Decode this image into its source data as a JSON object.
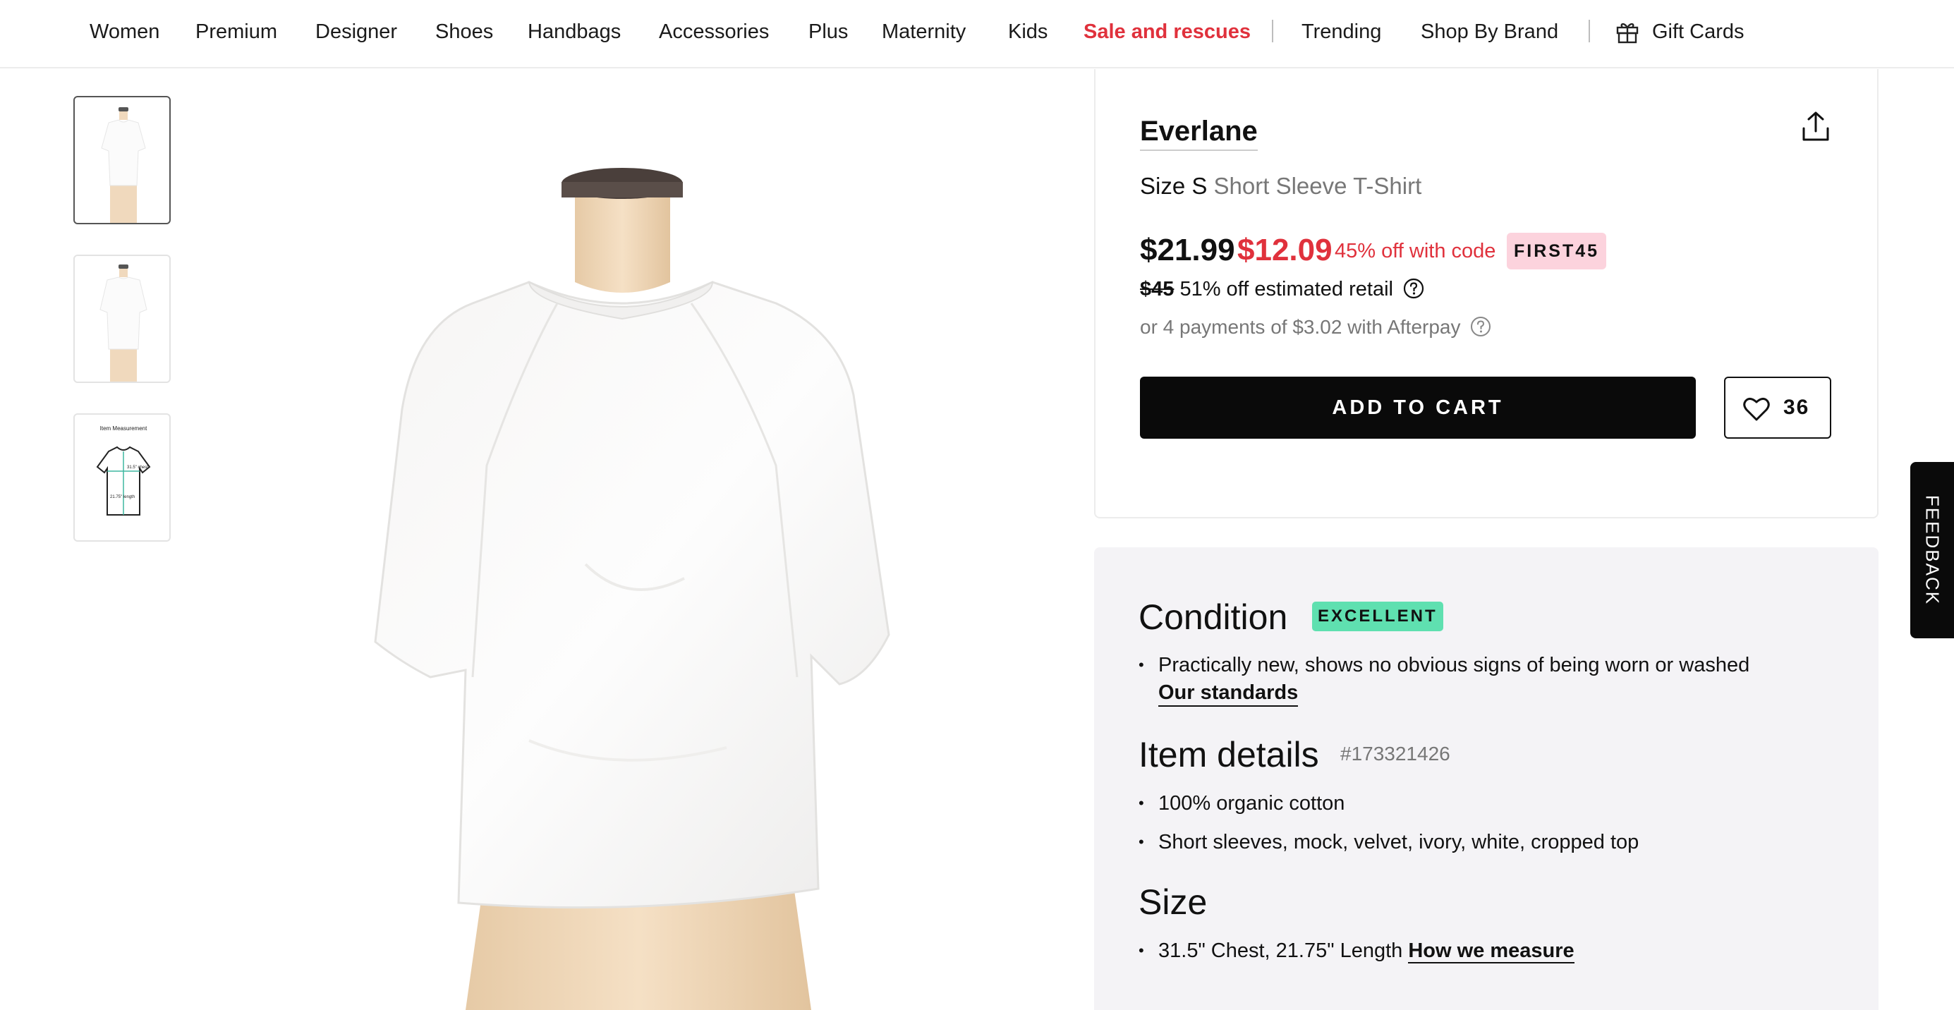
{
  "nav": {
    "items": [
      "Women",
      "Premium",
      "Designer",
      "Shoes",
      "Handbags",
      "Accessories",
      "Plus",
      "Maternity",
      "Kids"
    ],
    "sale": "Sale and rescues",
    "trending": "Trending",
    "shop_by_brand": "Shop By Brand",
    "gift_cards": "Gift Cards",
    "gift_icon": "gift-icon"
  },
  "gallery": {
    "thumbnails": [
      "front-view",
      "back-view",
      "measurement-diagram"
    ],
    "active_index": 0,
    "measurement": {
      "title": "Item Measurement",
      "chest": "31.5\" chest",
      "length": "21.75\" length"
    }
  },
  "product": {
    "brand": "Everlane",
    "size_label": "Size S",
    "type": "Short Sleeve T-Shirt",
    "price": "$21.99",
    "sale_price": "$12.09",
    "code_text": "45% off with code",
    "code": "FIRST45",
    "retail_price": "$45",
    "retail_text": "51% off estimated retail",
    "afterpay_text": "or 4 payments of $3.02 with Afterpay",
    "add_to_cart": "ADD TO CART",
    "favorites": "36",
    "share_icon": "share-icon"
  },
  "condition": {
    "title": "Condition",
    "badge": "EXCELLENT",
    "description": "Practically new, shows no obvious signs of being worn or washed",
    "standards_link": "Our standards"
  },
  "item_details": {
    "title": "Item details",
    "id": "#173321426",
    "bullets": [
      "100% organic cotton",
      "Short sleeves, mock, velvet, ivory, white, cropped top"
    ]
  },
  "size": {
    "title": "Size",
    "text": "31.5\" Chest, 21.75\" Length",
    "link": "How we measure"
  },
  "feedback": "FEEDBACK",
  "colors": {
    "sale_red": "#e0313c",
    "badge_pink": "#fcd3dd",
    "badge_green": "#5fe0b0",
    "panel_bg": "#f4f3f6"
  }
}
